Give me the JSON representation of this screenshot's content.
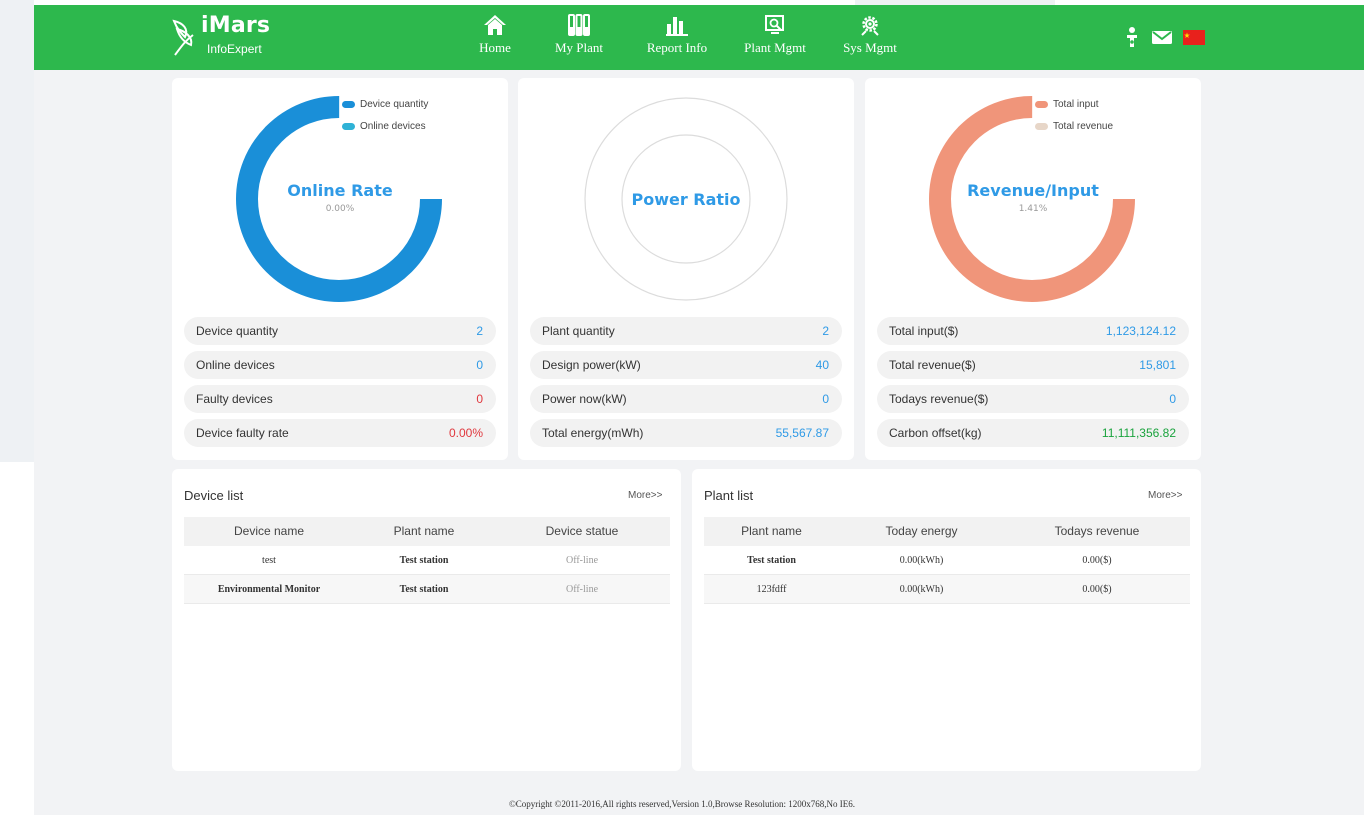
{
  "app": {
    "name": "iMars",
    "subtitle": "InfoExpert"
  },
  "nav": {
    "items": [
      {
        "label": "Home",
        "icon": "home-icon"
      },
      {
        "label": "My Plant",
        "icon": "plant-icon"
      },
      {
        "label": "Report Info",
        "icon": "report-icon"
      },
      {
        "label": "Plant Mgmt",
        "icon": "plant-mgmt-icon"
      },
      {
        "label": "Sys Mgmt",
        "icon": "gear-icon"
      }
    ]
  },
  "header_icons": [
    "user-icon",
    "mail-icon",
    "china-flag-icon"
  ],
  "colors": {
    "brand_green": "#2db84d",
    "accent_blue": "#2f9ae6",
    "donut_blue": "#1a8fd8",
    "donut_salmon": "#f0957a",
    "alert_red": "#e0383e",
    "positive_green": "#1aa33d"
  },
  "cards": {
    "online_rate": {
      "title": "Online Rate",
      "value": "0.00%",
      "legend": [
        {
          "label": "Device quantity",
          "color": "#1a8fd8"
        },
        {
          "label": "Online devices",
          "color": "#2fb2d6"
        }
      ],
      "ring_fraction": 0.75,
      "stats": [
        {
          "label": "Device quantity",
          "value": "2",
          "color": "#2f9ae6"
        },
        {
          "label": "Online devices",
          "value": "0",
          "color": "#2f9ae6"
        },
        {
          "label": "Faulty devices",
          "value": "0",
          "color": "#e0383e"
        },
        {
          "label": "Device faulty rate",
          "value": "0.00%",
          "color": "#e0383e"
        }
      ]
    },
    "power_ratio": {
      "title": "Power Ratio",
      "stats": [
        {
          "label": "Plant quantity",
          "value": "2",
          "color": "#2f9ae6"
        },
        {
          "label": "Design power(kW)",
          "value": "40",
          "color": "#2f9ae6"
        },
        {
          "label": "Power now(kW)",
          "value": "0",
          "color": "#2f9ae6"
        },
        {
          "label": "Total energy(mWh)",
          "value": "55,567.87",
          "color": "#2f9ae6"
        }
      ]
    },
    "revenue_input": {
      "title": "Revenue/Input",
      "value": "1.41%",
      "legend": [
        {
          "label": "Total input",
          "color": "#f0957a"
        },
        {
          "label": "Total revenue",
          "color": "#e7d6c8"
        }
      ],
      "ring_fraction": 0.75,
      "stats": [
        {
          "label": "Total input($)",
          "value": "1,123,124.12",
          "color": "#2f9ae6"
        },
        {
          "label": "Total revenue($)",
          "value": "15,801",
          "color": "#2f9ae6"
        },
        {
          "label": "Todays revenue($)",
          "value": "0",
          "color": "#2f9ae6"
        },
        {
          "label": "Carbon offset(kg)",
          "value": "11,111,356.82",
          "color": "#1aa33d"
        }
      ]
    }
  },
  "device_list": {
    "title": "Device list",
    "more": "More>>",
    "columns": [
      "Device name",
      "Plant name",
      "Device statue"
    ],
    "rows": [
      [
        "test",
        "Test station",
        "Off-line"
      ],
      [
        "Environmental Monitor",
        "Test station",
        "Off-line"
      ]
    ]
  },
  "plant_list": {
    "title": "Plant list",
    "more": "More>>",
    "columns": [
      "Plant name",
      "Today energy",
      "Todays revenue"
    ],
    "rows": [
      [
        "Test station",
        "0.00(kWh)",
        "0.00($)"
      ],
      [
        "123fdff",
        "0.00(kWh)",
        "0.00($)"
      ]
    ]
  },
  "footer": {
    "text": "©Copyright ©2011-2016,All rights reserved,Version 1.0,Browse Resolution: 1200x768,No IE6."
  }
}
